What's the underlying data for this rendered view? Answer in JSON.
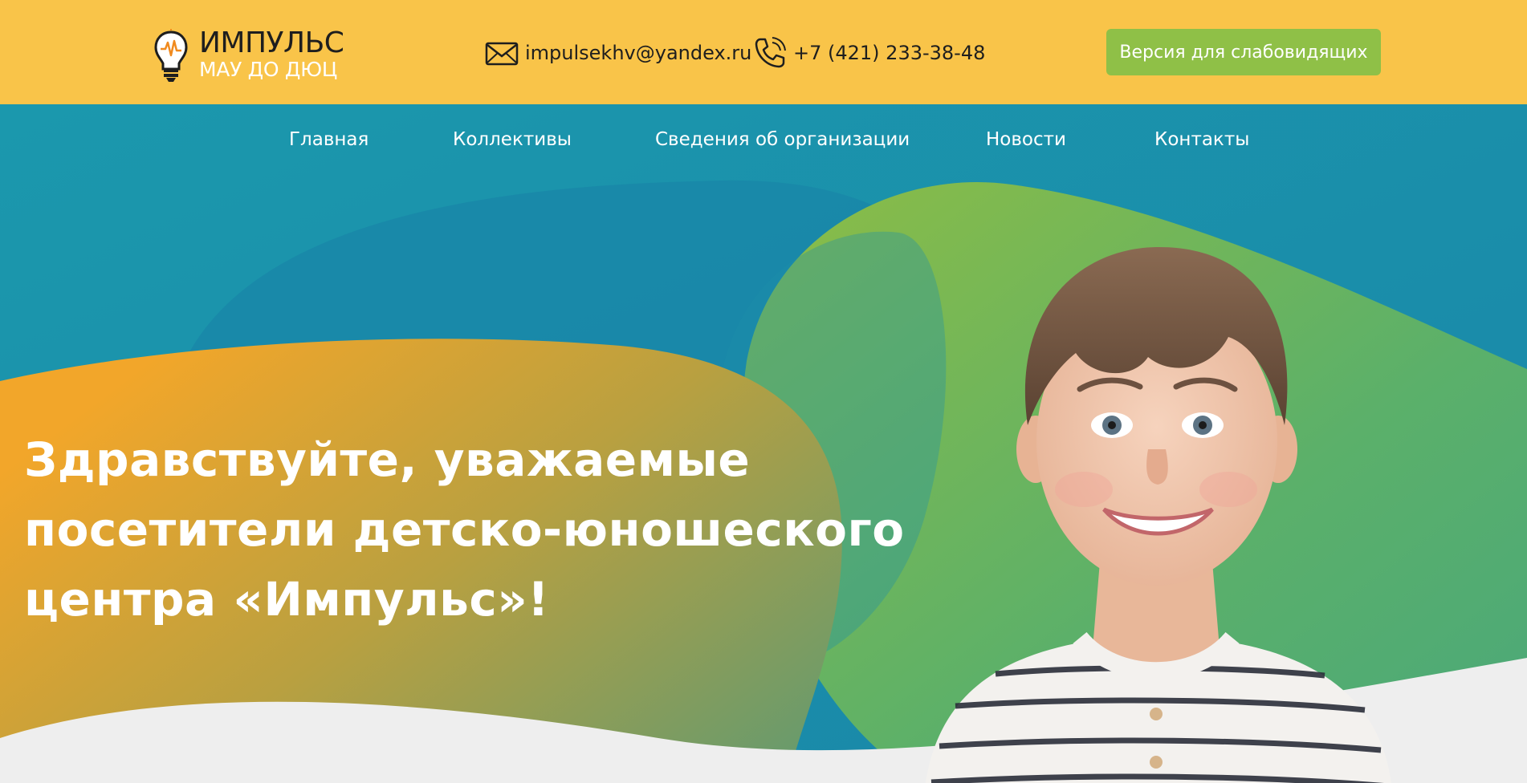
{
  "header": {
    "logo": {
      "title": "ИМПУЛЬС",
      "subtitle": "МАУ ДО ДЮЦ"
    },
    "email": {
      "icon": "envelope-icon",
      "text": "impulsekhv@yandex.ru"
    },
    "phone": {
      "icon": "phone-icon",
      "text": "+7 (421) 233-38-48"
    },
    "vision_button_label": "Версия для слабовидящих"
  },
  "nav": {
    "items": [
      {
        "label": "Главная"
      },
      {
        "label": "Коллективы"
      },
      {
        "label": "Сведения об организации"
      },
      {
        "label": "Новости"
      },
      {
        "label": "Контакты"
      }
    ]
  },
  "hero": {
    "title_lines": [
      "Здравствуйте, уважаемые",
      "посетители детско-юношеского",
      "центра «Импульс»!"
    ],
    "image": "smiling-boy-photo"
  },
  "colors": {
    "header_bg": "#f9c449",
    "hero_bg": "#1a97ad",
    "button_bg": "#8fc047",
    "accent_orange": "#f2a12a",
    "accent_green": "#8cbf45",
    "footer_wave": "#eeeeee"
  }
}
